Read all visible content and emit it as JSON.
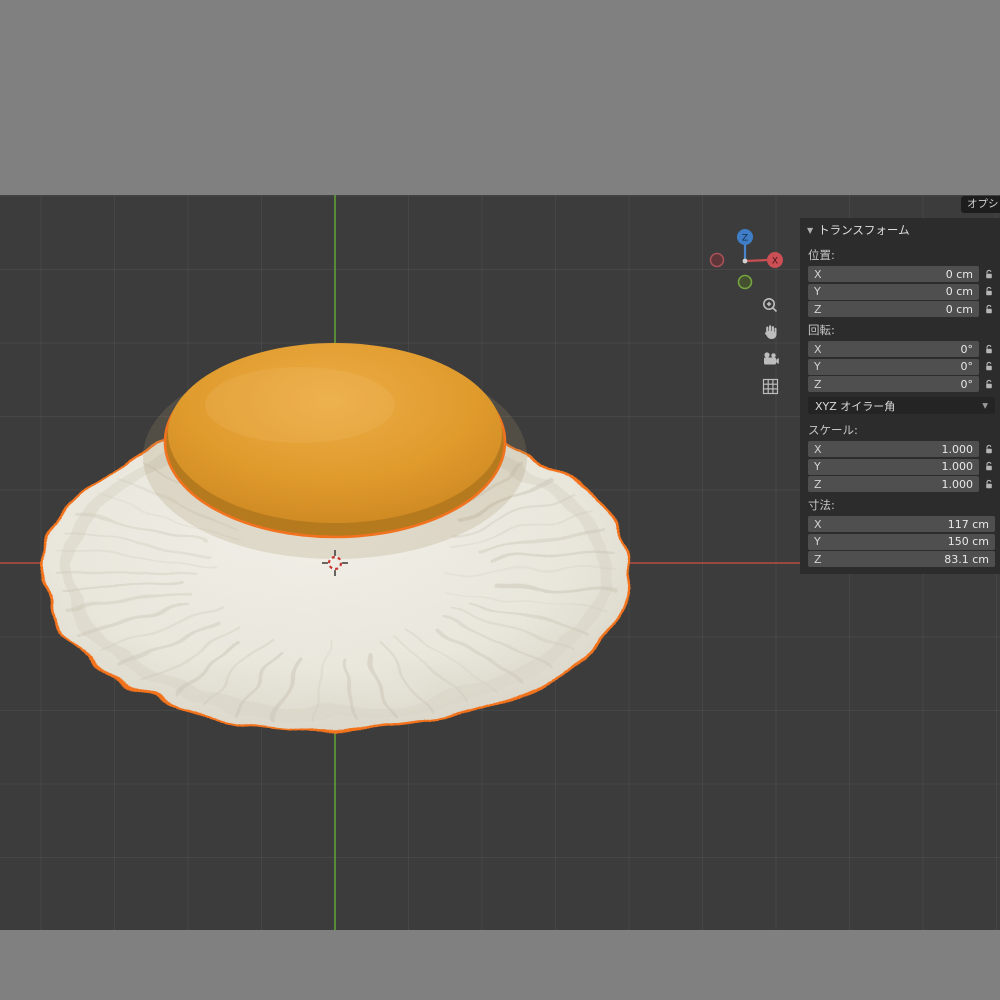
{
  "header": {
    "options_button": "オプシ"
  },
  "panel": {
    "title": "トランスフォーム",
    "location": {
      "label": "位置:",
      "rows": [
        {
          "axis": "X",
          "value": "0 cm"
        },
        {
          "axis": "Y",
          "value": "0 cm"
        },
        {
          "axis": "Z",
          "value": "0 cm"
        }
      ]
    },
    "rotation": {
      "label": "回転:",
      "rows": [
        {
          "axis": "X",
          "value": "0°"
        },
        {
          "axis": "Y",
          "value": "0°"
        },
        {
          "axis": "Z",
          "value": "0°"
        }
      ]
    },
    "rotation_mode": "XYZ オイラー角",
    "scale": {
      "label": "スケール:",
      "rows": [
        {
          "axis": "X",
          "value": "1.000"
        },
        {
          "axis": "Y",
          "value": "1.000"
        },
        {
          "axis": "Z",
          "value": "1.000"
        }
      ]
    },
    "dimensions": {
      "label": "寸法:",
      "rows": [
        {
          "axis": "X",
          "value": "117 cm"
        },
        {
          "axis": "Y",
          "value": "150 cm"
        },
        {
          "axis": "Z",
          "value": "83.1 cm"
        }
      ]
    }
  },
  "gizmo": {
    "z_label": "Z",
    "x_label": "X"
  },
  "colors": {
    "selection_outline": "#f2731f",
    "axis_x_red": "#a84a3f",
    "axis_y_green": "#5f9e35",
    "yolk": "#e09b2d",
    "egg_white": "#e9e6dc",
    "viewport_bg": "#3c3c3c",
    "panel_bg": "#2c2c2c",
    "letterbox": "#808080"
  }
}
